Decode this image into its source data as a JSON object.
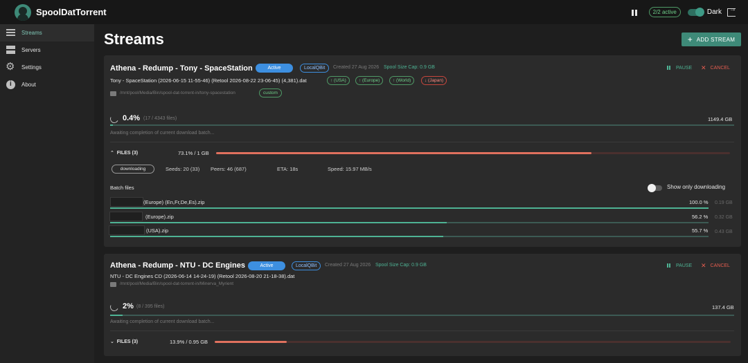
{
  "app": {
    "title": "SpoolDatTorrent"
  },
  "topbar": {
    "active_count": "2/2 active",
    "theme_label": "Dark"
  },
  "sidebar": {
    "items": [
      {
        "label": "Streams",
        "icon": "list-icon"
      },
      {
        "label": "Servers",
        "icon": "server-icon"
      },
      {
        "label": "Settings",
        "icon": "gear-icon"
      },
      {
        "label": "About",
        "icon": "info-icon"
      }
    ]
  },
  "page": {
    "title": "Streams",
    "add_stream_label": "ADD STREAM"
  },
  "colors": {
    "accent": "#3e8a78",
    "green": "#4eb394",
    "red": "#e35c4f",
    "blue": "#3d8fe0",
    "orange": "#e0715e"
  },
  "streams": [
    {
      "title": "Athena - Redump - Tony - SpaceStation",
      "status": "Active",
      "client": "LocalQBit",
      "created": "Created 27 Aug 2026",
      "spool_cap": "Spool Size Cap: 0.9 GB",
      "pause_label": "PAUSE",
      "cancel_label": "CANCEL",
      "dat_name": "Tony - SpaceStation (2026-06-15 11-55-46) (Retool 2026-08-22 23-06-45) (4,381).dat",
      "tags": [
        "↑ (USA)",
        "↑ (Europe)",
        "↑ (World)",
        "↓ (Japan)"
      ],
      "path": "/mnt/pool/Media/Bin/spool-dat-torrent-in/tony-spacestation",
      "path_tag": "custom",
      "progress_pct": "0.4%",
      "progress_value": 0.4,
      "file_count": "(17 / 4343 files)",
      "total_size": "1149.4 GB",
      "awaiting": "Awaiting completion of current download batch...",
      "files_label": "FILES (3)",
      "files_progress": "73.1% / 1 GB",
      "files_progress_value": 73.1,
      "batch_status": "downloading",
      "seeds": "Seeds: 20 (33)",
      "peers": "Peers: 46 (687)",
      "eta": "ETA: 18s",
      "speed": "Speed: 15.97 MB/s",
      "batch_label": "Batch files",
      "show_only_label": "Show only downloading",
      "files": [
        {
          "name": "(Europe) (En,Fr,De,Es).zip",
          "pct": "100.0 %",
          "value": 100.0,
          "size": "0.19 GB"
        },
        {
          "name": "(Europe).zip",
          "pct": "56.2 %",
          "value": 56.2,
          "size": "0.32 GB"
        },
        {
          "name": "(USA).zip",
          "pct": "55.7 %",
          "value": 55.7,
          "size": "0.43 GB"
        }
      ]
    },
    {
      "title": "Athena - Redump - NTU - DC Engines",
      "status": "Active",
      "client": "LocalQBit",
      "created": "Created 27 Aug 2026",
      "spool_cap": "Spool Size Cap: 0.9 GB",
      "pause_label": "PAUSE",
      "cancel_label": "CANCEL",
      "dat_name": "NTU - DC Engines CD (2026-06-14 14-24-19) (Retool 2026-08-20 21-18-38).dat",
      "path": "/mnt/pool/Media/Bin/spool-dat-torrent-in/Minerva_Myrient",
      "progress_pct": "2%",
      "progress_value": 2,
      "file_count": "(8 / 395 files)",
      "total_size": "137.4 GB",
      "awaiting": "Awaiting completion of current download batch...",
      "files_label": "FILES (3)",
      "files_progress": "13.9% / 0.95 GB",
      "files_progress_value": 13.9
    }
  ]
}
